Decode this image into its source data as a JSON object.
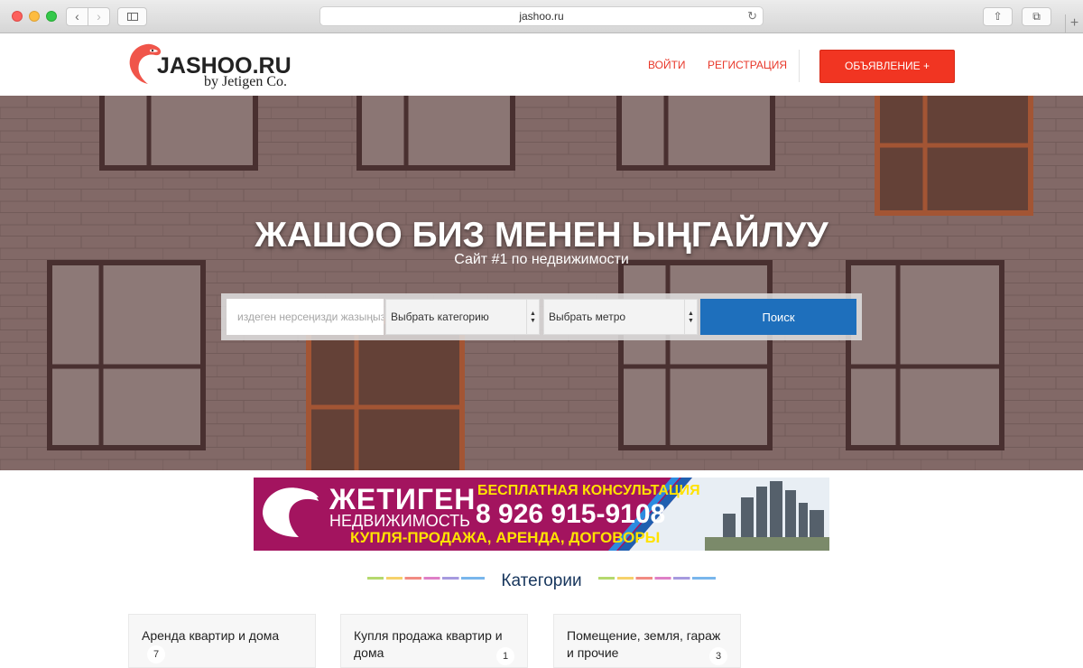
{
  "browser": {
    "url": "jashoo.ru",
    "back_icon": "‹",
    "forward_icon": "›",
    "reload_icon": "↻",
    "share_icon": "⇧",
    "tabs_icon": "⧉",
    "newtab_icon": "+"
  },
  "header": {
    "logo_text": "JASHOO.RU",
    "logo_sub": "by Jetigen Co.",
    "login": "ВОЙТИ",
    "register": "РЕГИСТРАЦИЯ",
    "post_ad": "ОБЪЯВЛЕНИЕ +"
  },
  "hero": {
    "title": "ЖАШОО БИЗ МЕНЕН ЫҢГАЙЛУУ",
    "subtitle": "Сайт #1 по недвижимости",
    "search_placeholder": "издеген нерсеңизди жазыңыз",
    "category_select": "Выбрать категорию",
    "metro_select": "Выбрать метро",
    "search_button": "Поиск"
  },
  "banner": {
    "brand": "ЖЕТИГЕН",
    "brand_sub": "НЕДВИЖИМОСТЬ",
    "consult": "БЕСПЛАТНАЯ КОНСУЛЬТАЦИЯ",
    "phone": "8 926 915-9108",
    "services": "КУПЛЯ-ПРОДАЖА, АРЕНДА, ДОГОВОРЫ"
  },
  "categories": {
    "heading": "Категории",
    "items": [
      {
        "label": "Аренда квартир и дома",
        "count": "7"
      },
      {
        "label": "Купля продажа квартир и дома",
        "count": "1"
      },
      {
        "label": "Помещение, земля, гараж и прочие",
        "count": "3"
      }
    ]
  },
  "colors": {
    "accent_red": "#f13522",
    "link_red": "#e8382a",
    "search_blue": "#1e6fbc",
    "banner_magenta": "#a3145f",
    "heading_navy": "#17365d"
  }
}
